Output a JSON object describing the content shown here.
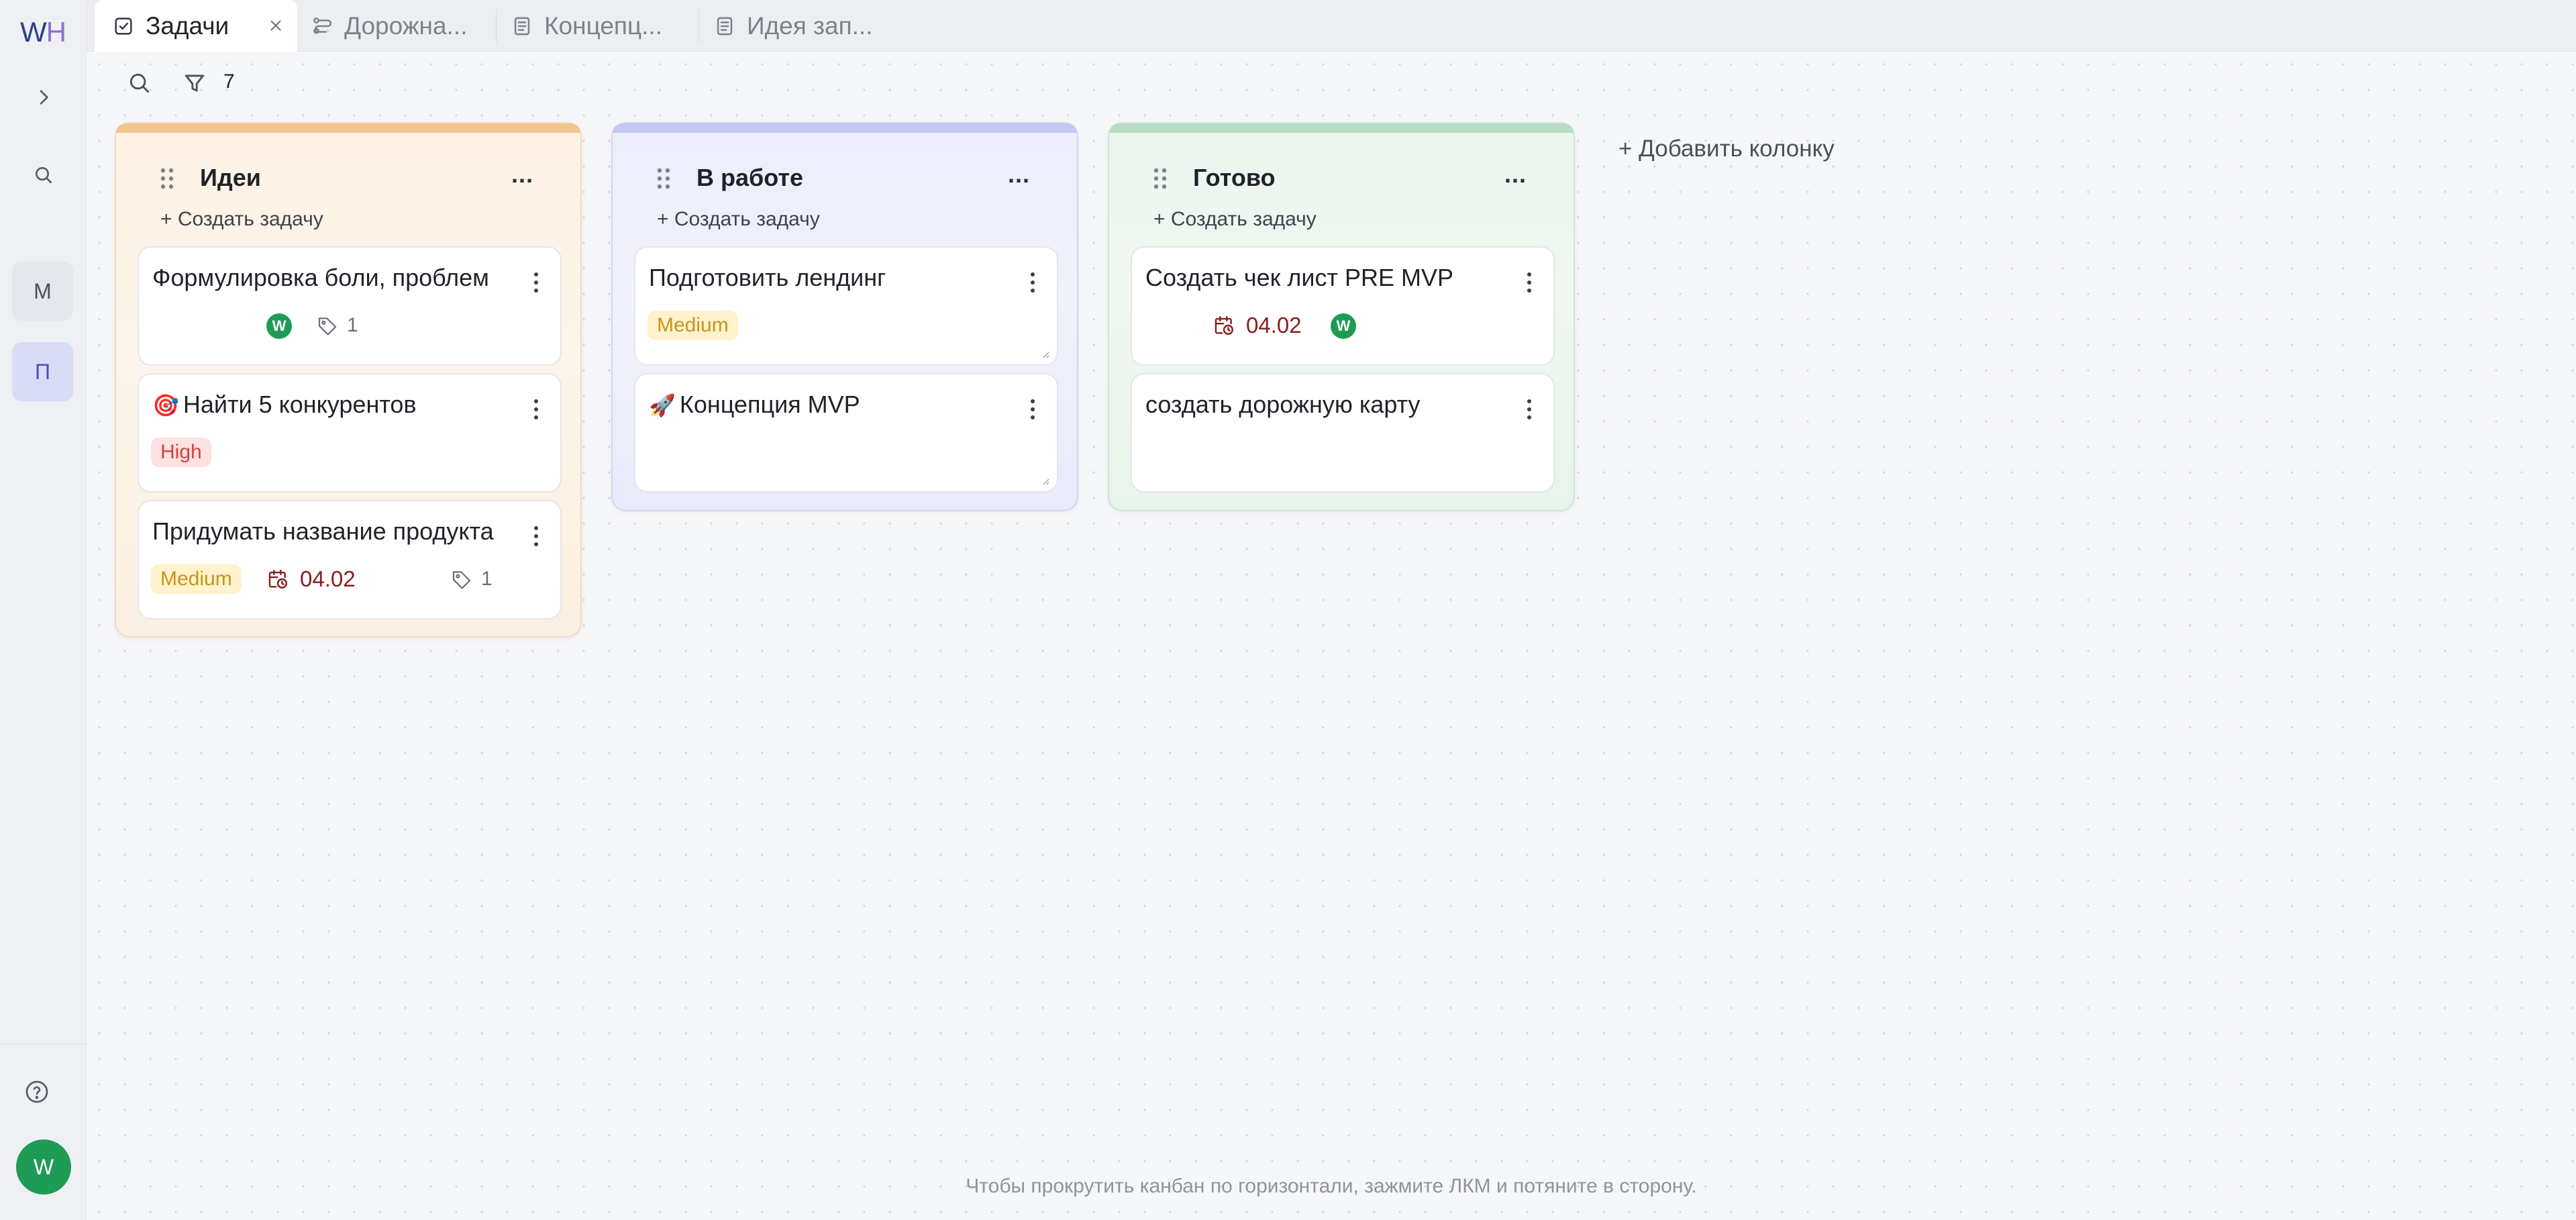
{
  "app": {
    "logo_w": "W",
    "logo_h": "H"
  },
  "sidebar": {
    "workspaces": [
      "М",
      "П"
    ],
    "avatar_initial": "W"
  },
  "tabs": [
    {
      "label": "Задачи",
      "icon": "task-icon",
      "active": true
    },
    {
      "label": "Дорожна...",
      "icon": "roadmap-icon",
      "active": false
    },
    {
      "label": "Концепц...",
      "icon": "document-icon",
      "active": false
    },
    {
      "label": "Идея зап...",
      "icon": "document-icon",
      "active": false
    }
  ],
  "toolbar": {
    "filter_count": "7"
  },
  "columns": [
    {
      "title": "Идеи",
      "color": "#f3c58e",
      "menu": "...",
      "create_label": "+ Создать задачу",
      "cards": [
        {
          "title": "Формулировка боли, проблем",
          "assignee": "W",
          "tags": "1"
        },
        {
          "title": "Найти 5 конкурентов",
          "emoji": "🎯",
          "priority": "High"
        },
        {
          "title": "Придумать название продукта",
          "priority": "Medium",
          "date": "04.02",
          "tags": "1"
        }
      ]
    },
    {
      "title": "В работе",
      "color": "#c3c8f3",
      "menu": "...",
      "create_label": "+ Создать задачу",
      "cards": [
        {
          "title": "Подготовить лендинг",
          "priority": "Medium"
        },
        {
          "title": "Концепция MVP",
          "emoji": "🚀"
        }
      ]
    },
    {
      "title": "Готово",
      "color": "#b7dcc2",
      "menu": "...",
      "create_label": "+ Создать задачу",
      "cards": [
        {
          "title": "Создать чек лист PRE MVP",
          "date": "04.02",
          "assignee": "W"
        },
        {
          "title": "создать дорожную карту"
        }
      ]
    }
  ],
  "add_column_label": "+ Добавить колонку",
  "hint": "Чтобы прокрутить канбан по горизонтали, зажмите ЛКМ и потяните в сторону."
}
